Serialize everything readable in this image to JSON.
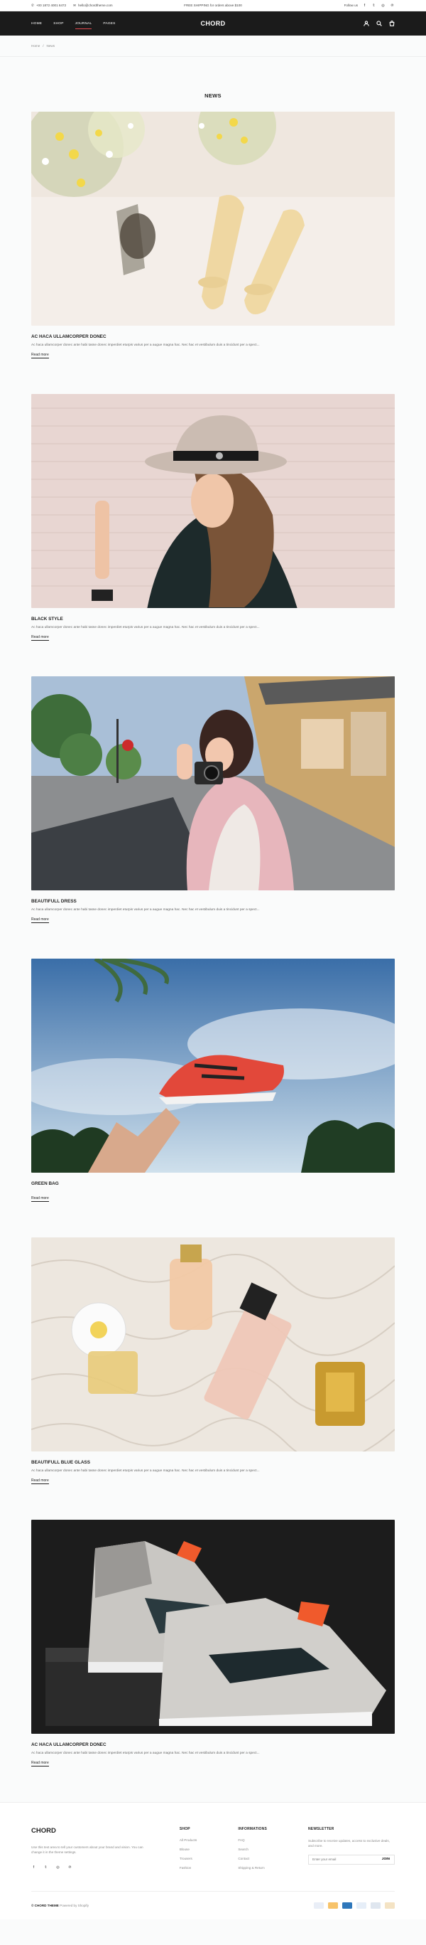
{
  "topbar": {
    "phone": "+00 1872 4001 6472",
    "email": "hello@chordtheme.com",
    "promo": "FREE SHIPPING for orders above $100",
    "follow": "Follow us"
  },
  "nav": {
    "items": [
      "HOME",
      "SHOP",
      "JOURNAL",
      "PAGES"
    ],
    "logo": "CHORD"
  },
  "breadcrumb": {
    "home": "Home",
    "sep": "/",
    "current": "News"
  },
  "page_title": "NEWS",
  "posts": [
    {
      "title": "AC HACA ULLAMCORPER DONEC",
      "excerpt": "Ac haca ullamcorper donec ante habi tasse donec imperdiet eturpis varius per a augue magna hac. Nec hac et vestibulum duis a tincidunt per a spect...",
      "more": "Read more"
    },
    {
      "title": "BLACK STYLE",
      "excerpt": "Ac haca ullamcorper donec ante habi tasse donec imperdiet eturpis varius per a augue magna hac. Nec hac et vestibulum duis a tincidunt per a spect...",
      "more": "Read more"
    },
    {
      "title": "BEAUTIFULL DRESS",
      "excerpt": "Ac haca ullamcorper donec ante habi tasse donec imperdiet eturpis varius per a augue magna hac. Nec hac et vestibulum duis a tincidunt per a spect...",
      "more": "Read more"
    },
    {
      "title": "GREEN BAG",
      "excerpt": "",
      "more": "Read more"
    },
    {
      "title": "BEAUTIFULL BLUE GLASS",
      "excerpt": "Ac haca ullamcorper donec ante habi tasse donec imperdiet eturpis varius per a augue magna hac. Nec hac et vestibulum duis a tincidunt per a spect...",
      "more": "Read more"
    },
    {
      "title": "AC HACA ULLAMCORPER DONEC",
      "excerpt": "Ac haca ullamcorper donec ante habi tasse donec imperdiet eturpis varius per a augue magna hac. Nec hac et vestibulum duis a tincidunt per a spect...",
      "more": "Read more"
    }
  ],
  "footer": {
    "logo": "CHORD",
    "about": "Use this text area to tell your customers about your brand and vision. You can change it in the theme settings.",
    "shop": {
      "title": "SHOP",
      "links": [
        "All Products",
        "Blouse",
        "Trousers",
        "Fashion"
      ]
    },
    "info": {
      "title": "INFORMATIONS",
      "links": [
        "FAQ",
        "Search",
        "Contact",
        "Shipping & Return"
      ]
    },
    "newsletter": {
      "title": "NEWSLETTER",
      "text": "Subscribe to receive updates, access to exclusive deals, and more.",
      "placeholder": "Enter your email",
      "button": "JOIN"
    },
    "copyright_brand": "© CHORD THEME",
    "copyright_rest": " Powered by Shopify"
  },
  "colors": {
    "nav_bg": "#1b1b1b",
    "accent": "#e0474c"
  }
}
